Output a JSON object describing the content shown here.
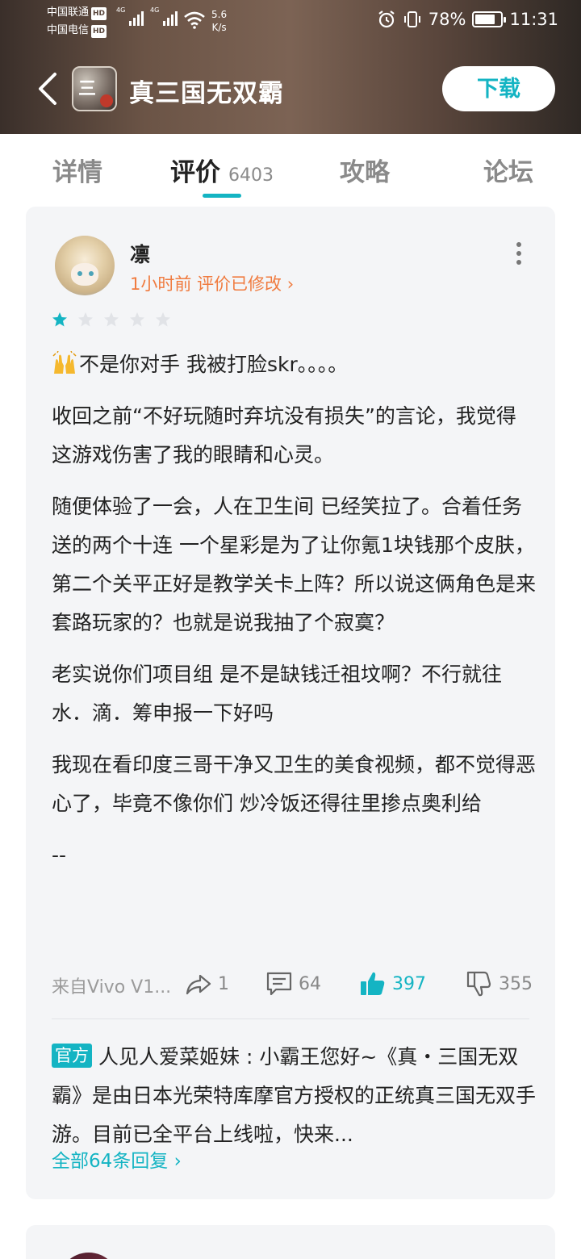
{
  "status_bar": {
    "carrier1": "中国联通",
    "carrier2": "中国电信",
    "hd": "HD",
    "network1": "4G",
    "network2": "4G",
    "speed_value": "5.6",
    "speed_unit": "K/s",
    "battery": "78%",
    "battery_level": 0.78,
    "time": "11:31"
  },
  "header": {
    "app_title": "真三国无双霸",
    "download_label": "下载"
  },
  "tabs": [
    {
      "label": "详情",
      "active": false
    },
    {
      "label": "评价",
      "count": "6403",
      "active": true
    },
    {
      "label": "攻略",
      "active": false
    },
    {
      "label": "论坛",
      "active": false
    }
  ],
  "review": {
    "username": "凛",
    "meta": "1小时前  评价已修改 ›",
    "rating": 1,
    "rating_max": 5,
    "paragraphs": [
      "不是你对手 我被打脸skr。。。。",
      "收回之前“不好玩随时弃坑没有损失”的言论，我觉得这游戏伤害了我的眼睛和心灵。",
      "随便体验了一会，人在卫生间 已经笑拉了。合着任务送的两个十连 一个星彩是为了让你氪1块钱那个皮肤，第二个关平正好是教学关卡上阵？所以说这俩角色是来套路玩家的？也就是说我抽了个寂寞？",
      "老实说你们项目组 是不是缺钱迁祖坟啊？不行就往水．滴．筹申报一下好吗",
      "我现在看印度三哥干净又卫生的美食视频，都不觉得恶心了，毕竟不像你们 炒冷饭还得往里掺点奥利给",
      "--"
    ],
    "from": "来自Vivo V1...",
    "share_count": "1",
    "comment_count": "64",
    "like_count": "397",
    "dislike_count": "355",
    "official_badge": "官方",
    "official_reply": "人见人爱菜姬妹 : 小霸王您好~《真・三国无双 霸》是由日本光荣特库摩官方授权的正统真三国无双手游。目前已全平台上线啦，快来...",
    "all_replies": "全部64条回复 ›"
  },
  "colors": {
    "accent": "#14b4c3",
    "meta_orange": "#f07b3f",
    "card_bg": "#f4f5f7"
  }
}
